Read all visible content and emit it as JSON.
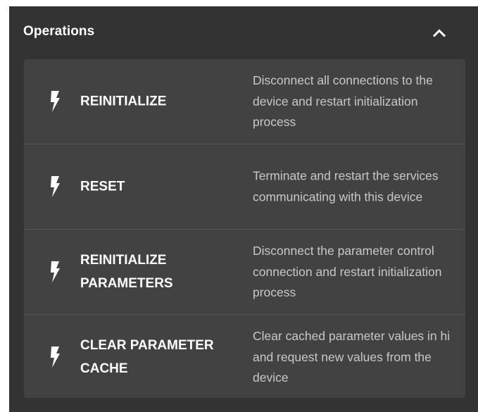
{
  "panel": {
    "title": "Operations",
    "collapse_icon": "chevron-up-icon"
  },
  "operations": [
    {
      "label": "REINITIALIZE",
      "description": "Disconnect all connections to the device and restart initialization process",
      "icon": "lightning-bolt-icon"
    },
    {
      "label": "RESET",
      "description": "Terminate and restart the services communicating with this device",
      "icon": "lightning-bolt-icon"
    },
    {
      "label": "REINITIALIZE PARAMETERS",
      "description": "Disconnect the parameter control connection and restart initialization process",
      "icon": "lightning-bolt-icon"
    },
    {
      "label": "CLEAR PARAMETER CACHE",
      "description": "Clear cached parameter values in hi and request new values from the device",
      "icon": "lightning-bolt-icon"
    }
  ],
  "colors": {
    "panel_background": "#333333",
    "card_background": "#424242",
    "divider": "#555555",
    "label_text": "#ffffff",
    "description_text": "#c8c8c8"
  }
}
